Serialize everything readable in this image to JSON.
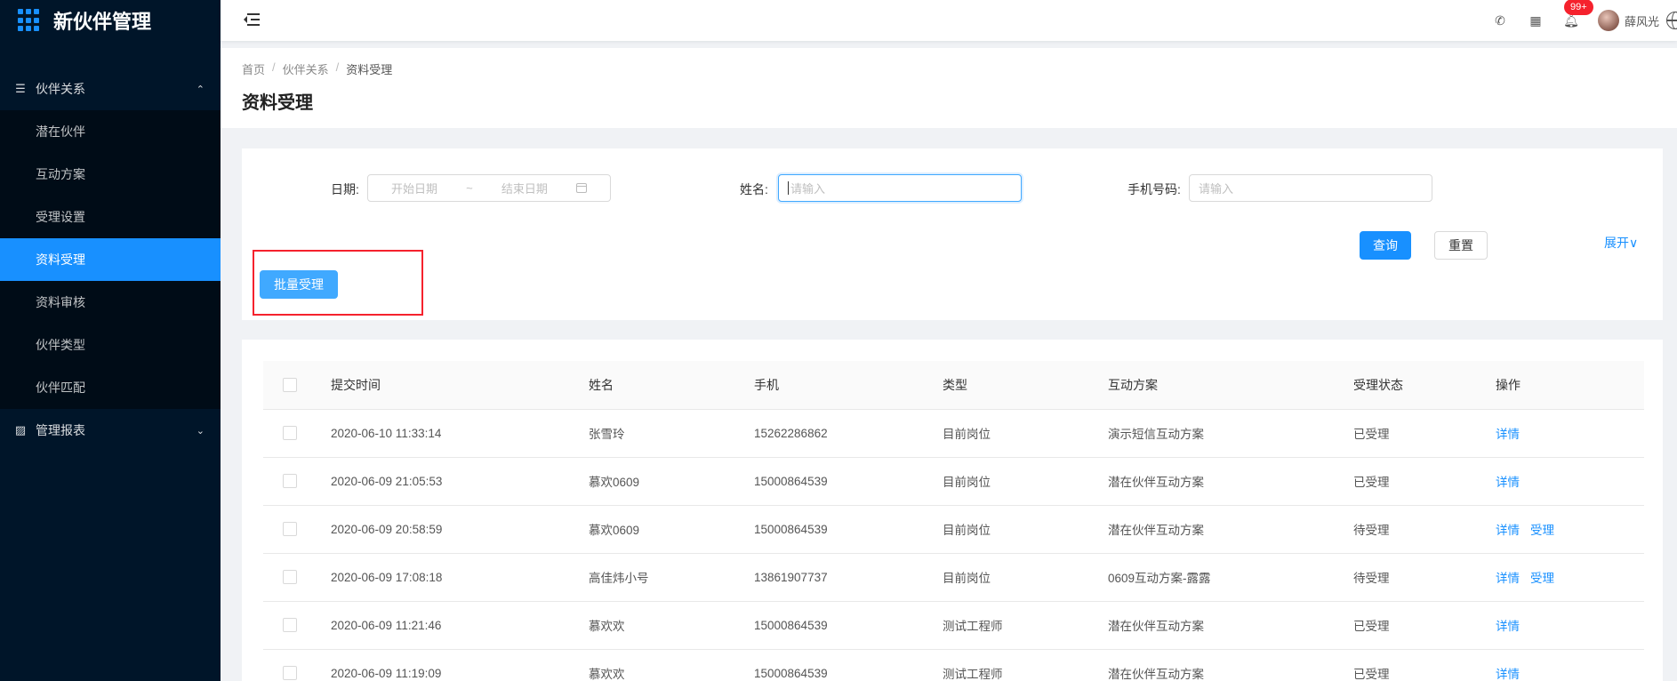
{
  "app": {
    "title": "新伙伴管理"
  },
  "sidebar": {
    "groups": [
      {
        "label": "伙伴关系",
        "icon": "list-icon",
        "expanded": true,
        "items": [
          "潜在伙伴",
          "互动方案",
          "受理设置",
          "资料受理",
          "资料审核",
          "伙伴类型",
          "伙伴匹配"
        ],
        "active": "资料受理"
      },
      {
        "label": "管理报表",
        "icon": "chart-icon",
        "expanded": false
      }
    ]
  },
  "header": {
    "badge": "99+",
    "username": "薛风光"
  },
  "breadcrumb": [
    "首页",
    "伙伴关系",
    "资料受理"
  ],
  "page_title": "资料受理",
  "filters": {
    "date_label": "日期:",
    "date_start_placeholder": "开始日期",
    "date_sep": "~",
    "date_end_placeholder": "结束日期",
    "name_label": "姓名:",
    "name_placeholder": "请输入",
    "phone_label": "手机号码:",
    "phone_placeholder": "请输入",
    "search_label": "查询",
    "reset_label": "重置",
    "expand_label": "展开",
    "batch_label": "批量受理"
  },
  "table": {
    "columns": [
      "提交时间",
      "姓名",
      "手机",
      "类型",
      "互动方案",
      "受理状态",
      "操作"
    ],
    "rows": [
      {
        "time": "2020-06-10 11:33:14",
        "name": "张雪玲",
        "phone": "15262286862",
        "type": "目前岗位",
        "plan": "演示短信互动方案",
        "status": "已受理",
        "actions": [
          "详情"
        ]
      },
      {
        "time": "2020-06-09 21:05:53",
        "name": "慕欢0609",
        "phone": "15000864539",
        "type": "目前岗位",
        "plan": "潜在伙伴互动方案",
        "status": "已受理",
        "actions": [
          "详情"
        ]
      },
      {
        "time": "2020-06-09 20:58:59",
        "name": "慕欢0609",
        "phone": "15000864539",
        "type": "目前岗位",
        "plan": "潜在伙伴互动方案",
        "status": "待受理",
        "actions": [
          "详情",
          "受理"
        ]
      },
      {
        "time": "2020-06-09 17:08:18",
        "name": "高佳炜小号",
        "phone": "13861907737",
        "type": "目前岗位",
        "plan": "0609互动方案-露露",
        "status": "待受理",
        "actions": [
          "详情",
          "受理"
        ]
      },
      {
        "time": "2020-06-09 11:21:46",
        "name": "慕欢欢",
        "phone": "15000864539",
        "type": "测试工程师",
        "plan": "潜在伙伴互动方案",
        "status": "已受理",
        "actions": [
          "详情"
        ]
      },
      {
        "time": "2020-06-09 11:19:09",
        "name": "慕欢欢",
        "phone": "15000864539",
        "type": "测试工程师",
        "plan": "潜在伙伴互动方案",
        "status": "已受理",
        "actions": [
          "详情"
        ]
      }
    ]
  },
  "colors": {
    "primary": "#1890ff",
    "sidebar_bg": "#001529",
    "highlight": "#f5222d"
  }
}
